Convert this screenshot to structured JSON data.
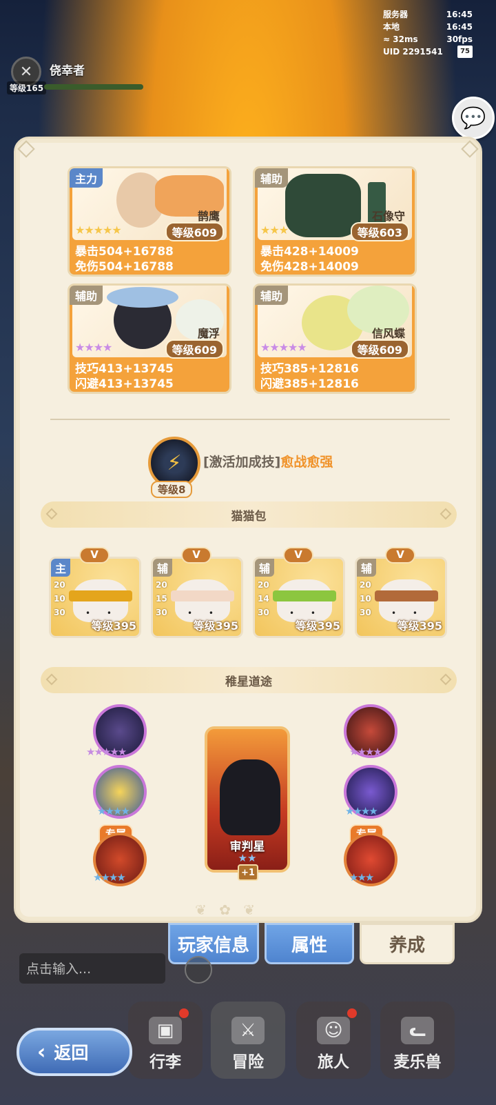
{
  "status": {
    "server_label": "服务器",
    "server_time": "16:45",
    "local_label": "本地",
    "local_time": "16:45",
    "ping": "32ms",
    "fps": "30fps",
    "uid": "UID 2291541",
    "battery": "75"
  },
  "player": {
    "name": "侥幸者",
    "level": "等级165"
  },
  "pets": [
    {
      "role": "主力",
      "name": "鹊鹰",
      "level": "等级609",
      "stat1": "暴击504+16788",
      "stat2": "免伤504+16788",
      "stars": "★★★★★"
    },
    {
      "role": "辅助",
      "name": "石像守",
      "level": "等级603",
      "stat1": "暴击428+14009",
      "stat2": "免伤428+14009",
      "stars": "★★★"
    },
    {
      "role": "辅助",
      "name": "魔浮",
      "level": "等级609",
      "stat1": "技巧413+13745",
      "stat2": "闪避413+13745",
      "stars": "★★★★"
    },
    {
      "role": "辅助",
      "name": "信风蝶",
      "level": "等级609",
      "stat1": "技巧385+12816",
      "stat2": "闪避385+12816",
      "stars": "★★★★★"
    }
  ],
  "skill": {
    "level": "等级8",
    "prefix": "[激活加成技]",
    "name": "愈战愈强"
  },
  "cat_section": "猫猫包",
  "cats": [
    {
      "badge": "V",
      "role": "主",
      "nums": [
        "20",
        "10",
        "30"
      ],
      "level": "等级395",
      "band": "#e4a51c"
    },
    {
      "badge": "V",
      "role": "辅",
      "nums": [
        "20",
        "15",
        "30"
      ],
      "level": "等级395",
      "band": "#f2d8c6"
    },
    {
      "badge": "V",
      "role": "辅",
      "nums": [
        "20",
        "14",
        "30"
      ],
      "level": "等级395",
      "band": "#8cc63f"
    },
    {
      "badge": "V",
      "role": "辅",
      "nums": [
        "20",
        "10",
        "30"
      ],
      "level": "等级395",
      "band": "#b26a3a"
    }
  ],
  "star_section": "稚星道途",
  "star_path": {
    "exclusive_tag": "专属",
    "center_name": "审判星",
    "center_plus": "+1"
  },
  "tabs": {
    "player_info": "玩家信息",
    "attributes": "属性",
    "develop": "养成"
  },
  "chat_placeholder": "点击输入...",
  "nav": {
    "back": "返回",
    "bag": "行李",
    "adventure": "冒险",
    "traveler": "旅人",
    "pets": "麦乐兽"
  },
  "colors": {
    "accent_orange": "#f4a23b",
    "tab_blue": "#5b8fd6",
    "panel_bg": "#f6efdf",
    "skill_orange": "#f0932b"
  }
}
